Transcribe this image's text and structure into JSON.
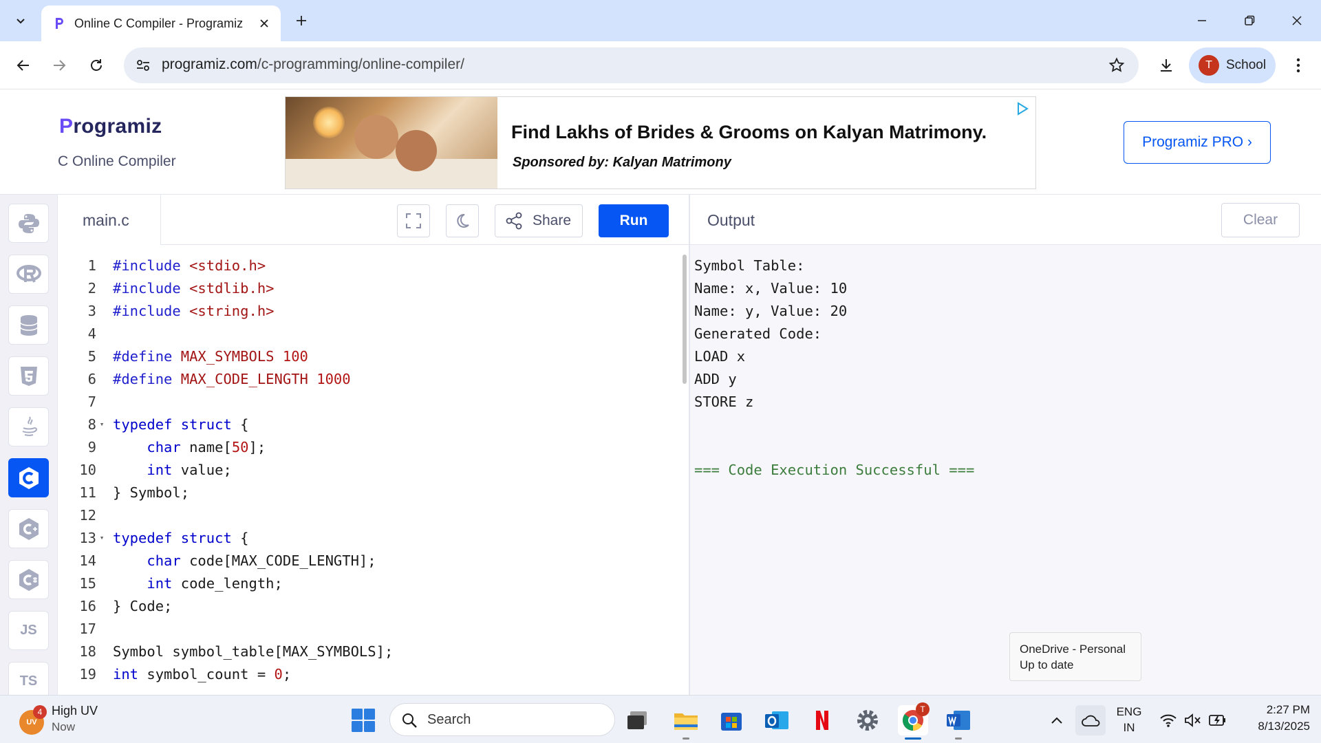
{
  "browser": {
    "tab_title": "Online C Compiler - Programiz",
    "url_host": "programiz.com",
    "url_path": "/c-programming/online-compiler/",
    "profile_initial": "T",
    "profile_name": "School"
  },
  "header": {
    "logo_text_p": "P",
    "logo_text_rest": "rogramiz",
    "subtitle": "C Online Compiler",
    "ad_headline": "Find Lakhs of Brides & Grooms on Kalyan Matrimony.",
    "ad_sponsor": "Sponsored by: Kalyan Matrimony",
    "pro_button": "Programiz PRO ›"
  },
  "languages": [
    {
      "id": "python",
      "icon": "python-icon",
      "label": ""
    },
    {
      "id": "r",
      "icon": "r-icon",
      "label": ""
    },
    {
      "id": "sql",
      "icon": "database-icon",
      "label": ""
    },
    {
      "id": "html",
      "icon": "html5-icon",
      "label": ""
    },
    {
      "id": "java",
      "icon": "java-icon",
      "label": ""
    },
    {
      "id": "c",
      "icon": "c-icon",
      "label": "",
      "active": true
    },
    {
      "id": "cpp",
      "icon": "cpp-icon",
      "label": ""
    },
    {
      "id": "csharp",
      "icon": "csharp-icon",
      "label": ""
    },
    {
      "id": "js",
      "icon": "js-icon",
      "label": "JS"
    },
    {
      "id": "ts",
      "icon": "ts-icon",
      "label": "TS"
    }
  ],
  "editor": {
    "file_name": "main.c",
    "share_label": "Share",
    "run_label": "Run",
    "lines": [
      {
        "n": "1",
        "fold": "",
        "code": "#include <stdio.h>"
      },
      {
        "n": "2",
        "fold": "",
        "code": "#include <stdlib.h>"
      },
      {
        "n": "3",
        "fold": "",
        "code": "#include <string.h>"
      },
      {
        "n": "4",
        "fold": "",
        "code": ""
      },
      {
        "n": "5",
        "fold": "",
        "code": "#define MAX_SYMBOLS 100"
      },
      {
        "n": "6",
        "fold": "",
        "code": "#define MAX_CODE_LENGTH 1000"
      },
      {
        "n": "7",
        "fold": "",
        "code": ""
      },
      {
        "n": "8",
        "fold": "▾",
        "code": "typedef struct {"
      },
      {
        "n": "9",
        "fold": "",
        "code": "    char name[50];"
      },
      {
        "n": "10",
        "fold": "",
        "code": "    int value;"
      },
      {
        "n": "11",
        "fold": "",
        "code": "} Symbol;"
      },
      {
        "n": "12",
        "fold": "",
        "code": ""
      },
      {
        "n": "13",
        "fold": "▾",
        "code": "typedef struct {"
      },
      {
        "n": "14",
        "fold": "",
        "code": "    char code[MAX_CODE_LENGTH];"
      },
      {
        "n": "15",
        "fold": "",
        "code": "    int code_length;"
      },
      {
        "n": "16",
        "fold": "",
        "code": "} Code;"
      },
      {
        "n": "17",
        "fold": "",
        "code": ""
      },
      {
        "n": "18",
        "fold": "",
        "code": "Symbol symbol_table[MAX_SYMBOLS];"
      },
      {
        "n": "19",
        "fold": "",
        "code": "int symbol_count = 0;"
      }
    ]
  },
  "output": {
    "title": "Output",
    "clear_label": "Clear",
    "lines": [
      "Symbol Table:",
      "Name: x, Value: 10",
      "Name: y, Value: 20",
      "Generated Code:",
      "LOAD x",
      "ADD y",
      "STORE z",
      "",
      "",
      "=== Code Execution Successful ==="
    ]
  },
  "notification": {
    "line1": "OneDrive - Personal",
    "line2": "Up to date"
  },
  "taskbar": {
    "weather_badge": "4",
    "weather_icon_text": "UV",
    "weather_title": "High UV",
    "weather_sub": "Now",
    "search_placeholder": "Search",
    "chrome_badge": "T",
    "lang_top": "ENG",
    "lang_bottom": "IN",
    "time": "2:27 PM",
    "date": "8/13/2025"
  }
}
